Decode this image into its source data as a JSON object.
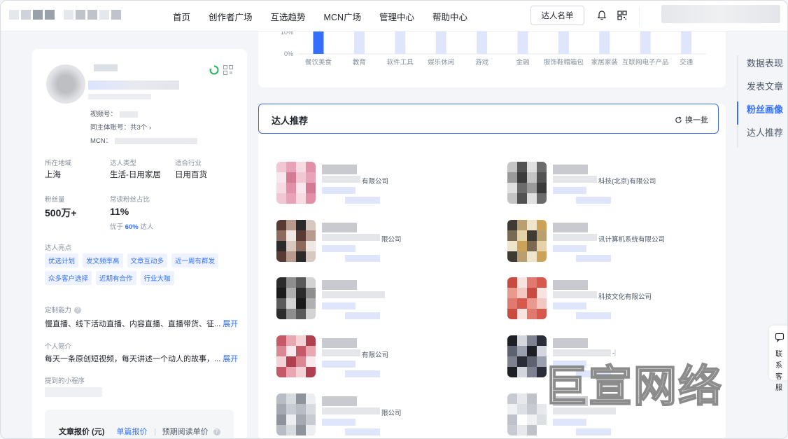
{
  "nav": {
    "items": [
      "首页",
      "创作者广场",
      "互选趋势",
      "MCN广场",
      "管理中心",
      "帮助中心"
    ],
    "talent_list_button": "达人名单"
  },
  "profile": {
    "video_label": "视频号：",
    "same_subject_label": "同主体账号：",
    "same_subject_value": "共3个 ›",
    "mcn_label": "MCN：",
    "region_label": "所在地域",
    "region_value": "上海",
    "type_label": "达人类型",
    "type_value": "生活-日用家居",
    "industry_label": "适合行业",
    "industry_value": "日用百货",
    "fans_label": "粉丝量",
    "fans_value": "500万+",
    "read_ratio_label": "常读粉丝占比",
    "read_ratio_value": "11%",
    "better_prefix": "优于",
    "better_value": "60%",
    "better_suffix": "达人",
    "highlights_label": "达人亮点",
    "highlights": [
      "优选计划",
      "发文频率高",
      "文章互动多",
      "近一周有群发",
      "众多客户选择",
      "近期有合作",
      "行业大咖"
    ],
    "custom_label": "定制能力",
    "custom_value": "慢直播、线下活动直播、内容直播、直播带货、征...",
    "custom_more": "展开",
    "intro_label": "个人简介",
    "intro_value": "每天一条原创短视频，每天讲述一个动人的故事，...",
    "intro_more": "展开",
    "mini_program_label": "提到的小程序",
    "price_title": "文章报价 (元)",
    "price_tab_single": "单篇报价",
    "price_tab_read": "预期阅读单价"
  },
  "chart_data": {
    "type": "bar",
    "categories": [
      "餐饮美食",
      "教育",
      "软件工具",
      "娱乐休闲",
      "游戏",
      "金融",
      "服饰鞋帽箱包",
      "家居家装",
      "互联网电子产品",
      "交通"
    ],
    "ytick_labels": [
      "10%",
      "0%"
    ],
    "highlight_category": "餐饮美食",
    "colors": {
      "highlight": "#3370ff",
      "muted": "#dfe6fb",
      "text": "#86909c"
    }
  },
  "recommend": {
    "title": "达人推荐",
    "refresh_label": "换一批",
    "items": [
      {
        "company": "有限公司"
      },
      {
        "company": "科技(北京)有限公司"
      },
      {
        "company": "限公司"
      },
      {
        "company": "讯计算机系统有限公司"
      },
      {
        "company": ""
      },
      {
        "company": "科技文化有限公司"
      },
      {
        "company": "有限公司"
      },
      {
        "company": "-"
      },
      {
        "company": "限公司"
      },
      {
        "company": ""
      }
    ]
  },
  "anchor": {
    "items": [
      "数据表现",
      "发表文章",
      "粉丝画像",
      "达人推荐"
    ],
    "active": "粉丝画像"
  },
  "contact": {
    "label": "联系客服"
  },
  "watermark": "巨宣网络"
}
